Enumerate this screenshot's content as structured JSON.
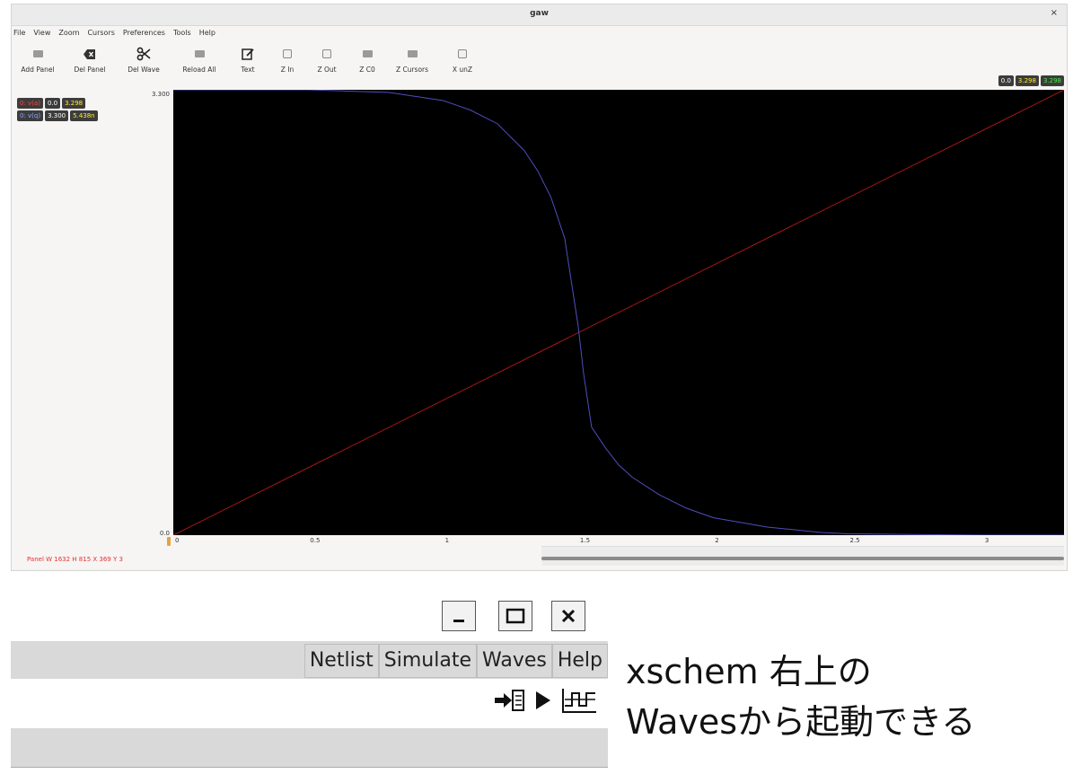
{
  "gaw": {
    "title": "gaw",
    "close_glyph": "×",
    "menu": [
      "File",
      "View",
      "Zoom",
      "Cursors",
      "Preferences",
      "Tools",
      "Help"
    ],
    "toolbar": [
      {
        "label": "Add Panel",
        "icon": "add-panel-icon"
      },
      {
        "label": "Del Panel",
        "icon": "del-panel-icon"
      },
      {
        "label": "Del Wave",
        "icon": "scissors-icon"
      },
      {
        "label": "Reload All",
        "icon": "reload-icon"
      },
      {
        "label": "Text",
        "icon": "text-edit-icon"
      },
      {
        "label": "Z In",
        "icon": "zoom-in-icon"
      },
      {
        "label": "Z Out",
        "icon": "zoom-out-icon"
      },
      {
        "label": "Z C0",
        "icon": "zoom-c0-icon"
      },
      {
        "label": "Z Cursors",
        "icon": "zoom-cursors-icon"
      },
      {
        "label": "X unZ",
        "icon": "x-unzoom-icon"
      }
    ],
    "cursor_values": [
      "0.0",
      "3.298",
      "3.298"
    ],
    "waves": [
      {
        "name": "0: v(a)",
        "v1": "0.0",
        "v2": "3.298",
        "color": "#ff4444"
      },
      {
        "name": "0: v(q)",
        "v1": "3.300",
        "v2": "5.438n",
        "color": "#8fa8ff"
      }
    ],
    "y_max": "3.300",
    "y_min": "0.0",
    "status": "Panel W 1632 H 815 X 369 Y 3",
    "colors": {
      "plot_bg": "#000000",
      "wave_a": "#b01818",
      "wave_q": "#4e4ebe"
    }
  },
  "chart_data": {
    "type": "line",
    "xlim": [
      0,
      3.3
    ],
    "ylim": [
      0,
      3.3
    ],
    "x_ticks": [
      "0",
      "0.5",
      "1",
      "1.5",
      "2",
      "2.5",
      "3"
    ],
    "y_tick_labels": [
      "3.300",
      "0.0"
    ],
    "series": [
      {
        "name": "0: v(a)",
        "color": "#b01818",
        "x": [
          0,
          3.3
        ],
        "y": [
          0,
          3.3
        ]
      },
      {
        "name": "0: v(q)",
        "color": "#4e4ebe",
        "x": [
          0,
          0.5,
          0.8,
          1.0,
          1.1,
          1.2,
          1.3,
          1.35,
          1.4,
          1.45,
          1.5,
          1.52,
          1.55,
          1.6,
          1.65,
          1.7,
          1.8,
          1.9,
          2.0,
          2.2,
          2.4,
          2.5,
          3.0,
          3.3
        ],
        "y": [
          3.3,
          3.3,
          3.28,
          3.22,
          3.15,
          3.05,
          2.85,
          2.7,
          2.5,
          2.2,
          1.55,
          1.2,
          0.8,
          0.65,
          0.52,
          0.43,
          0.3,
          0.2,
          0.13,
          0.06,
          0.02,
          0.01,
          0.0,
          0.0
        ]
      }
    ]
  },
  "xschem": {
    "window_buttons": [
      "minimize-icon",
      "maximize-icon",
      "close-icon"
    ],
    "menu": [
      "Netlist",
      "Simulate",
      "Waves",
      "Help"
    ],
    "tools": [
      "netlist-arrow-icon",
      "play-icon",
      "waves-icon"
    ]
  },
  "caption": {
    "line1": "xschem 右上の",
    "line2": "Wavesから起動できる"
  }
}
